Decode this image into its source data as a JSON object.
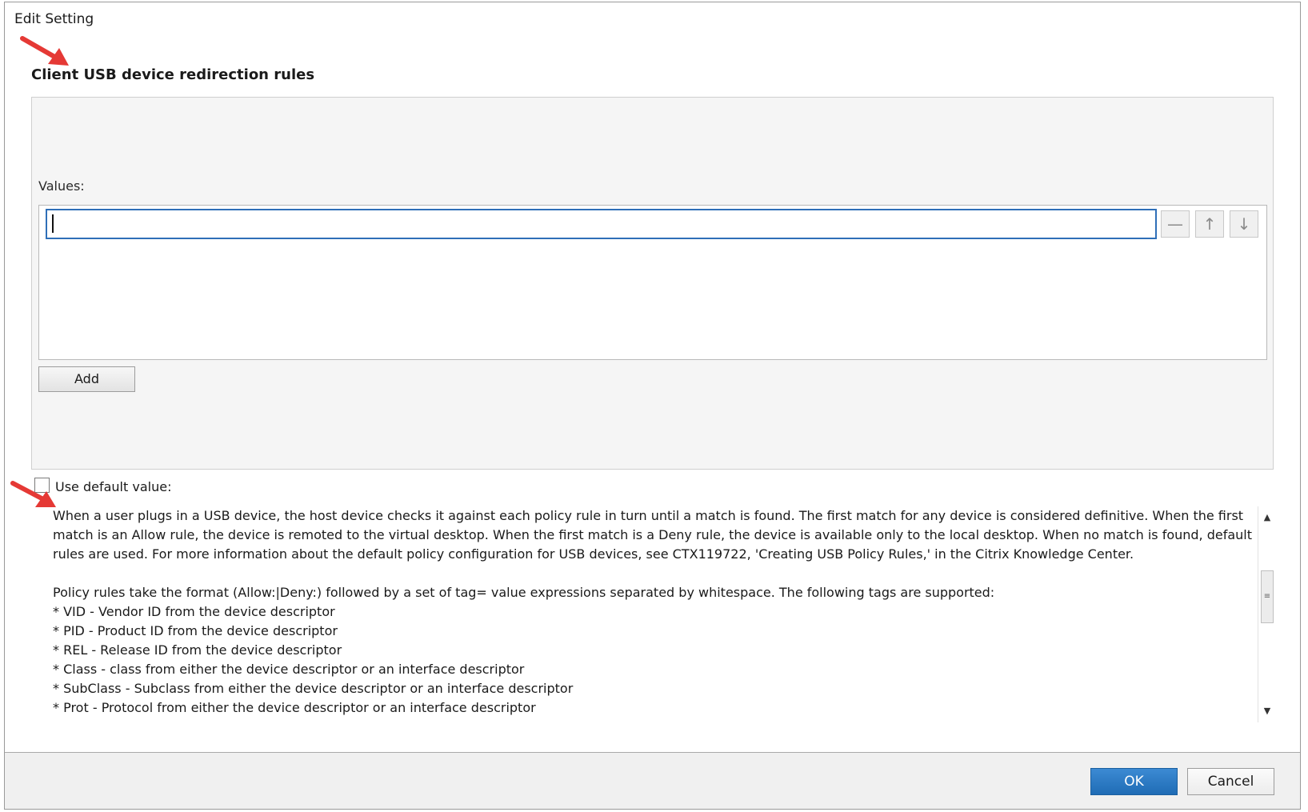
{
  "window": {
    "title": "Edit Setting"
  },
  "setting": {
    "heading": "Client USB device redirection rules"
  },
  "values": {
    "label": "Values:",
    "input_value": "",
    "remove_icon": "minus-icon",
    "up_icon": "arrow-up-icon",
    "down_icon": "arrow-down-icon",
    "add_label": "Add"
  },
  "default_value": {
    "label": "Use default value:",
    "checked": false
  },
  "description": {
    "paragraph1": "When a user plugs in a USB device, the host device checks it against each policy rule in turn until a match is found. The first match for any device is considered definitive. When the first match is an Allow rule, the device is remoted to the virtual desktop. When the first match is a Deny rule, the device is available only to the local desktop. When no match is found, default rules are used. For more information about the default policy configuration for USB devices, see CTX119722, 'Creating USB Policy Rules,' in the Citrix Knowledge Center.",
    "paragraph2": "Policy rules take the format (Allow:|Deny:) followed by a set of tag= value expressions separated by whitespace. The following tags are supported:",
    "tags": [
      "* VID - Vendor ID from the device descriptor",
      "* PID - Product ID from the device descriptor",
      "* REL - Release ID from the device descriptor",
      "* Class - class from either the device descriptor or an interface descriptor",
      "* SubClass - Subclass from either the device descriptor or an interface descriptor",
      "* Prot - Protocol from either the device descriptor or an interface descriptor"
    ]
  },
  "footer": {
    "ok_label": "OK",
    "cancel_label": "Cancel"
  },
  "colors": {
    "annotation_arrow": "#e53935",
    "ok_button": "#2a78c4",
    "input_focus_border": "#2f6fb8"
  }
}
